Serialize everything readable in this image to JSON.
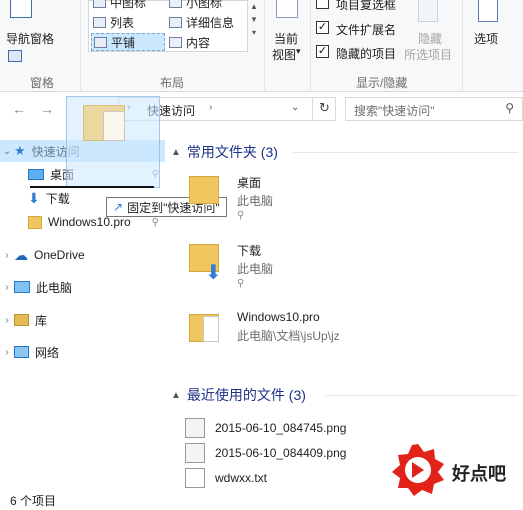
{
  "ribbon": {
    "nav_pane_label": "导航窗格",
    "pane_group": "窗格",
    "layout_group": "布局",
    "show_hide_group": "显示/隐藏",
    "layout_items": [
      "中图标",
      "小图标",
      "列表",
      "详细信息",
      "平铺",
      "内容"
    ],
    "current_view_label": "当前",
    "current_view_label2": "视图",
    "options_label": "选项",
    "checkbox_item_checkboxes": "项目复选框",
    "checkbox_extensions": "文件扩展名",
    "checkbox_hidden_items": "隐藏的项目",
    "hide_selected_label": "隐藏",
    "hide_selected_label2": "所选项目"
  },
  "address": {
    "path_label": "快速访问",
    "search_placeholder": "搜索\"快速访问\""
  },
  "nav_pane": {
    "quick_access": "快速访问",
    "items": [
      "桌面",
      "下载",
      "Windows10.pro"
    ],
    "onedrive": "OneDrive",
    "this_pc": "此电脑",
    "libraries": "库",
    "network": "网络"
  },
  "drag_tooltip": "固定到\"快速访问\"",
  "content": {
    "frequent_header": "常用文件夹 (3)",
    "folders": [
      {
        "name": "桌面",
        "location": "此电脑"
      },
      {
        "name": "下载",
        "location": "此电脑"
      },
      {
        "name": "Windows10.pro",
        "location": "此电脑\\文档\\jsUp\\jz"
      }
    ],
    "recent_header": "最近使用的文件 (3)",
    "recent_files": [
      "2015-06-10_084745.png",
      "2015-06-10_084409.png",
      "wdwxx.txt"
    ]
  },
  "status": {
    "item_count": "6 个项目"
  },
  "watermark": {
    "text": "好点吧"
  },
  "colors": {
    "selection": "#cce8ff",
    "accent_blue": "#1e3287",
    "folder_yellow": "#f0c75e",
    "watermark_red": "#e2231a"
  }
}
